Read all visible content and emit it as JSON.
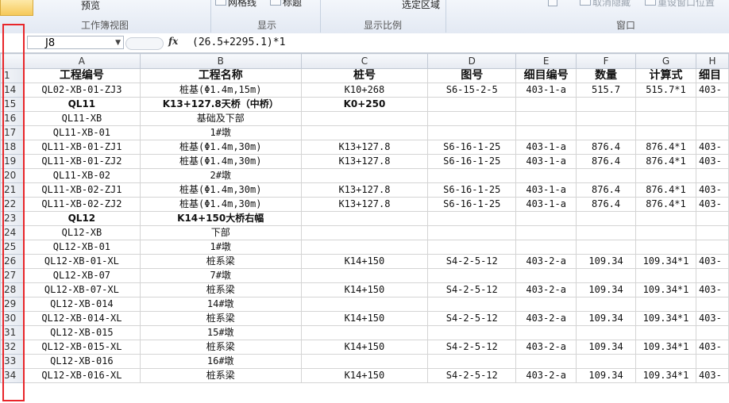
{
  "ribbon": {
    "preview_label": "预览",
    "group_workbook_views": "工作簿视图",
    "group_show": "显示",
    "group_zoom": "显示比例",
    "group_window": "窗口",
    "gridlines_label": "网格线",
    "headings_label": "标题",
    "zoom_selection_label": "选定区域",
    "unhide_label": "取消隐藏",
    "reset_window_label": "重设窗口位置"
  },
  "formula_bar": {
    "name_box": "J8",
    "fx": "fx",
    "formula": "(26.5+2295.1)*1"
  },
  "columns": [
    "A",
    "B",
    "C",
    "D",
    "E",
    "F",
    "G",
    "H"
  ],
  "header_row": {
    "row_num": "1",
    "cells": [
      "工程编号",
      "工程名称",
      "桩号",
      "图号",
      "细目编号",
      "数量",
      "计算式",
      "细目"
    ]
  },
  "rows": [
    {
      "row_num": "14",
      "cells": [
        "QL02-XB-01-ZJ3",
        "桩基(Φ1.4m,15m)",
        "K10+268",
        "S6-15-2-5",
        "403-1-a",
        "515.7",
        "515.7*1",
        "403-"
      ],
      "bold": false
    },
    {
      "row_num": "15",
      "cells": [
        "QL11",
        "K13+127.8天桥（中桥）",
        "K0+250",
        "",
        "",
        "",
        "",
        ""
      ],
      "bold": true
    },
    {
      "row_num": "16",
      "cells": [
        "QL11-XB",
        "基础及下部",
        "",
        "",
        "",
        "",
        "",
        ""
      ],
      "bold": false
    },
    {
      "row_num": "17",
      "cells": [
        "QL11-XB-01",
        "1#墩",
        "",
        "",
        "",
        "",
        "",
        ""
      ],
      "bold": false
    },
    {
      "row_num": "18",
      "cells": [
        "QL11-XB-01-ZJ1",
        "桩基(Φ1.4m,30m)",
        "K13+127.8",
        "S6-16-1-25",
        "403-1-a",
        "876.4",
        "876.4*1",
        "403-"
      ],
      "bold": false
    },
    {
      "row_num": "19",
      "cells": [
        "QL11-XB-01-ZJ2",
        "桩基(Φ1.4m,30m)",
        "K13+127.8",
        "S6-16-1-25",
        "403-1-a",
        "876.4",
        "876.4*1",
        "403-"
      ],
      "bold": false
    },
    {
      "row_num": "20",
      "cells": [
        "QL11-XB-02",
        "2#墩",
        "",
        "",
        "",
        "",
        "",
        ""
      ],
      "bold": false
    },
    {
      "row_num": "21",
      "cells": [
        "QL11-XB-02-ZJ1",
        "桩基(Φ1.4m,30m)",
        "K13+127.8",
        "S6-16-1-25",
        "403-1-a",
        "876.4",
        "876.4*1",
        "403-"
      ],
      "bold": false
    },
    {
      "row_num": "22",
      "cells": [
        "QL11-XB-02-ZJ2",
        "桩基(Φ1.4m,30m)",
        "K13+127.8",
        "S6-16-1-25",
        "403-1-a",
        "876.4",
        "876.4*1",
        "403-"
      ],
      "bold": false
    },
    {
      "row_num": "23",
      "cells": [
        "QL12",
        "K14+150大桥右幅",
        "",
        "",
        "",
        "",
        "",
        ""
      ],
      "bold": true
    },
    {
      "row_num": "24",
      "cells": [
        "QL12-XB",
        "下部",
        "",
        "",
        "",
        "",
        "",
        ""
      ],
      "bold": false
    },
    {
      "row_num": "25",
      "cells": [
        "QL12-XB-01",
        "1#墩",
        "",
        "",
        "",
        "",
        "",
        ""
      ],
      "bold": false
    },
    {
      "row_num": "26",
      "cells": [
        "QL12-XB-01-XL",
        "桩系梁",
        "K14+150",
        "S4-2-5-12",
        "403-2-a",
        "109.34",
        "109.34*1",
        "403-"
      ],
      "bold": false
    },
    {
      "row_num": "27",
      "cells": [
        "QL12-XB-07",
        "7#墩",
        "",
        "",
        "",
        "",
        "",
        ""
      ],
      "bold": false
    },
    {
      "row_num": "28",
      "cells": [
        "QL12-XB-07-XL",
        "桩系梁",
        "K14+150",
        "S4-2-5-12",
        "403-2-a",
        "109.34",
        "109.34*1",
        "403-"
      ],
      "bold": false
    },
    {
      "row_num": "29",
      "cells": [
        "QL12-XB-014",
        "14#墩",
        "",
        "",
        "",
        "",
        "",
        ""
      ],
      "bold": false
    },
    {
      "row_num": "30",
      "cells": [
        "QL12-XB-014-XL",
        "桩系梁",
        "K14+150",
        "S4-2-5-12",
        "403-2-a",
        "109.34",
        "109.34*1",
        "403-"
      ],
      "bold": false
    },
    {
      "row_num": "31",
      "cells": [
        "QL12-XB-015",
        "15#墩",
        "",
        "",
        "",
        "",
        "",
        ""
      ],
      "bold": false
    },
    {
      "row_num": "32",
      "cells": [
        "QL12-XB-015-XL",
        "桩系梁",
        "K14+150",
        "S4-2-5-12",
        "403-2-a",
        "109.34",
        "109.34*1",
        "403-"
      ],
      "bold": false
    },
    {
      "row_num": "33",
      "cells": [
        "QL12-XB-016",
        "16#墩",
        "",
        "",
        "",
        "",
        "",
        ""
      ],
      "bold": false
    },
    {
      "row_num": "34",
      "cells": [
        "QL12-XB-016-XL",
        "桩系梁",
        "K14+150",
        "S4-2-5-12",
        "403-2-a",
        "109.34",
        "109.34*1",
        "403-"
      ],
      "bold": false
    }
  ],
  "colors": {
    "highlight_box": "#e8262a",
    "ribbon_bg": "#e3e9f3",
    "grid_line": "#d4d4d4"
  }
}
